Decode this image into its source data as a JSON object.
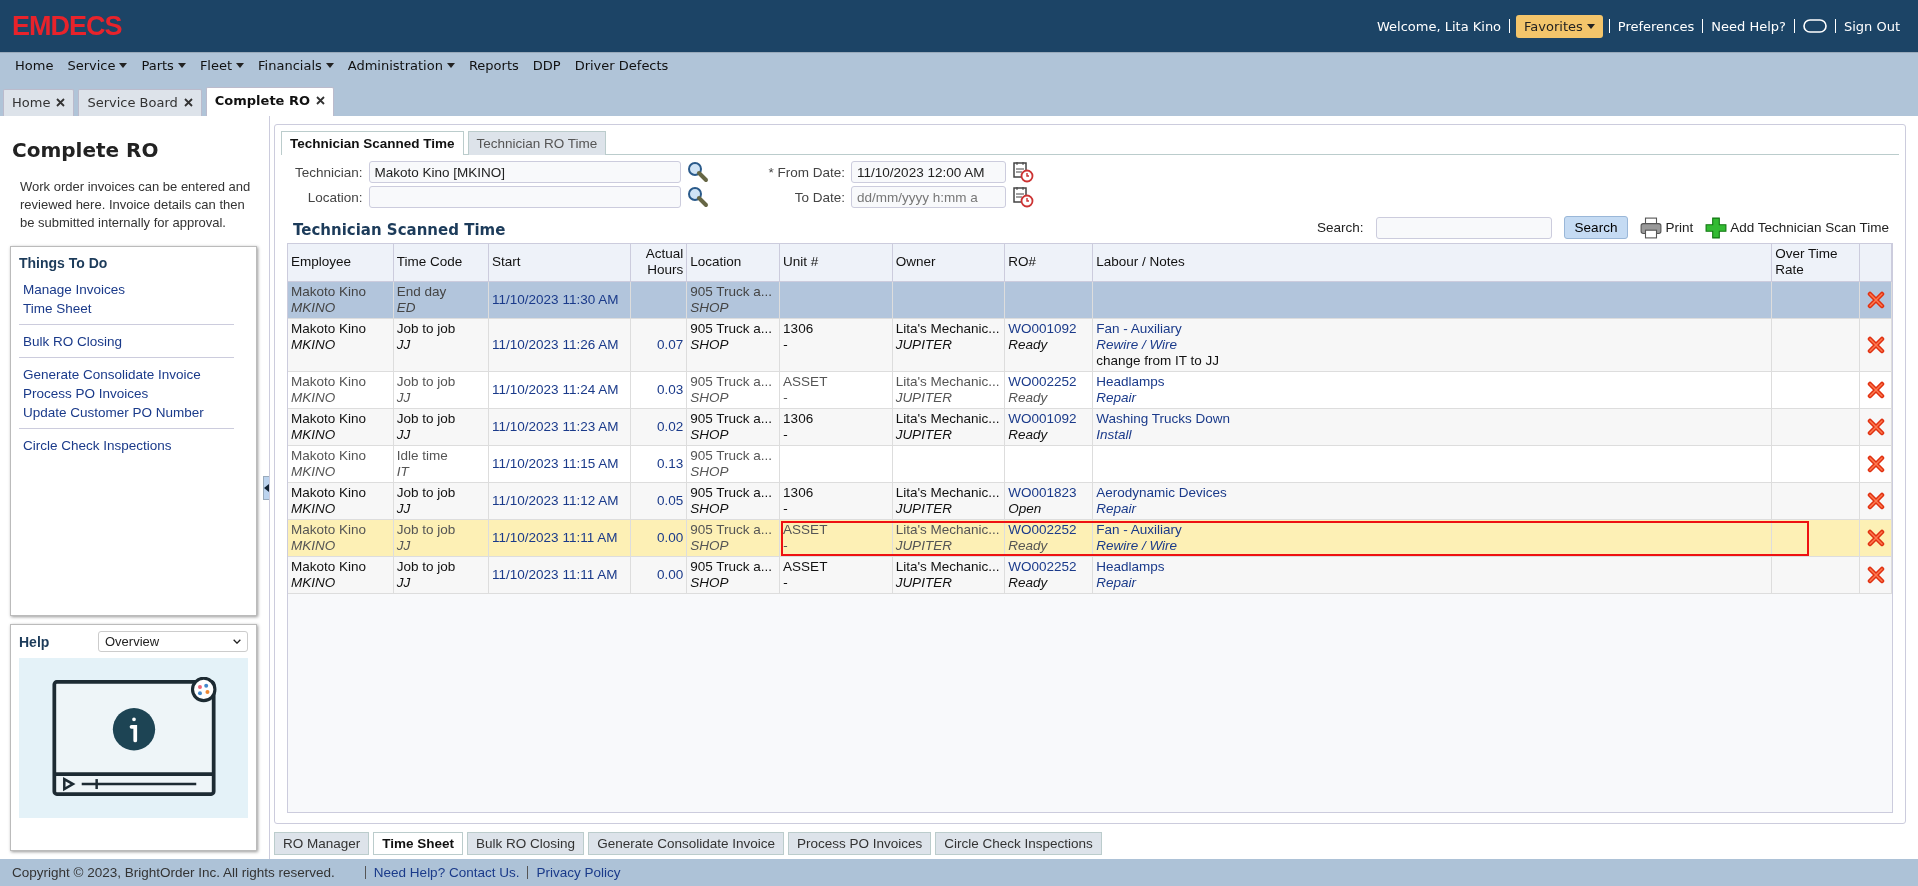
{
  "header": {
    "logo": "EMDECS",
    "welcome": "Welcome, Lita Kino",
    "favorites": "Favorites",
    "links": [
      {
        "kind": "link",
        "label": "Preferences"
      },
      {
        "kind": "link",
        "label": "Need Help?"
      },
      {
        "kind": "toggle"
      },
      {
        "kind": "link",
        "label": "Sign Out"
      }
    ]
  },
  "menu": [
    {
      "label": "Home",
      "has_menu": false
    },
    {
      "label": "Service",
      "has_menu": true
    },
    {
      "label": "Parts",
      "has_menu": true
    },
    {
      "label": "Fleet",
      "has_menu": true
    },
    {
      "label": "Financials",
      "has_menu": true
    },
    {
      "label": "Administration",
      "has_menu": true
    },
    {
      "label": "Reports",
      "has_menu": false
    },
    {
      "label": "DDP",
      "has_menu": false
    },
    {
      "label": "Driver Defects",
      "has_menu": false
    }
  ],
  "page_tabs": [
    {
      "label": "Home",
      "selected": false
    },
    {
      "label": "Service Board",
      "selected": false
    },
    {
      "label": "Complete RO",
      "selected": true
    }
  ],
  "sidebar": {
    "title": "Complete RO",
    "description": "Work order invoices can be entered and reviewed here. Invoice details can then be submitted internally for approval.",
    "things_to_do": {
      "title": "Things To Do",
      "groups": [
        [
          "Manage Invoices",
          "Time Sheet"
        ],
        [
          "Bulk RO Closing"
        ],
        [
          "Generate Consolidate Invoice",
          "Process PO Invoices",
          "Update Customer PO Number"
        ],
        [
          "Circle Check Inspections"
        ]
      ]
    },
    "help": {
      "title": "Help",
      "topic": "Overview"
    }
  },
  "content_tabs": [
    {
      "label": "Technician Scanned Time",
      "selected": true
    },
    {
      "label": "Technician RO Time",
      "selected": false
    }
  ],
  "filters": {
    "technician": {
      "label": "Technician:",
      "value": "Makoto Kino [MKINO]"
    },
    "location": {
      "label": "Location:"
    },
    "from_date": {
      "label": "* From Date:",
      "value": "11/10/2023 12:00 AM"
    },
    "to_date": {
      "label": "To Date:",
      "placeholder": "dd/mm/yyyy h:mm a"
    }
  },
  "section_title": "Technician Scanned Time",
  "toolbar": {
    "search_label": "Search:",
    "search_button": "Search",
    "print": "Print",
    "add": "Add Technician Scan Time"
  },
  "table": {
    "columns": [
      "Employee",
      "Time Code",
      "Start",
      "Actual Hours",
      "Location",
      "Unit #",
      "Owner",
      "RO#",
      "Labour / Notes",
      "Over Time Rate"
    ],
    "rows": [
      {
        "employee": "Makoto Kino",
        "employee_code": "MKINO",
        "time_code": "End day",
        "time_code_short": "ED",
        "start": "11/10/2023 11:30 AM",
        "location": "905 Truck a...",
        "location_code": "SHOP",
        "selected": true,
        "hovered": false,
        "outlined": false
      },
      {
        "employee": "Makoto Kino",
        "employee_code": "MKINO",
        "time_code": "Job to job",
        "time_code_short": "JJ",
        "start": "11/10/2023 11:26 AM",
        "hours": "0.07",
        "location": "905 Truck a...",
        "location_code": "SHOP",
        "unit": "1306",
        "unit_sub": "-",
        "owner": "Lita's Mechanic...",
        "owner_code": "JUPITER",
        "ro": "WO001092",
        "ro_status": "Ready",
        "labour": "Fan - Auxiliary",
        "labour_sub": "Rewire / Wire",
        "note": "change from IT to JJ",
        "selected": false,
        "hovered": false,
        "outlined": false
      },
      {
        "employee": "Makoto Kino",
        "employee_code": "MKINO",
        "time_code": "Job to job",
        "time_code_short": "JJ",
        "start": "11/10/2023 11:24 AM",
        "hours": "0.03",
        "location": "905 Truck a...",
        "location_code": "SHOP",
        "unit": "ASSET",
        "unit_sub": "-",
        "owner": "Lita's Mechanic...",
        "owner_code": "JUPITER",
        "ro": "WO002252",
        "ro_status": "Ready",
        "labour": "Headlamps",
        "labour_sub": "Repair",
        "selected": false,
        "hovered": false,
        "outlined": false
      },
      {
        "employee": "Makoto Kino",
        "employee_code": "MKINO",
        "time_code": "Job to job",
        "time_code_short": "JJ",
        "start": "11/10/2023 11:23 AM",
        "hours": "0.02",
        "location": "905 Truck a...",
        "location_code": "SHOP",
        "unit": "1306",
        "unit_sub": "-",
        "owner": "Lita's Mechanic...",
        "owner_code": "JUPITER",
        "ro": "WO001092",
        "ro_status": "Ready",
        "labour": "Washing Trucks Down",
        "labour_sub": "Install",
        "selected": false,
        "hovered": false,
        "outlined": false
      },
      {
        "employee": "Makoto Kino",
        "employee_code": "MKINO",
        "time_code": "Idle time",
        "time_code_short": "IT",
        "start": "11/10/2023 11:15 AM",
        "hours": "0.13",
        "location": "905 Truck a...",
        "location_code": "SHOP",
        "selected": false,
        "hovered": false,
        "outlined": false
      },
      {
        "employee": "Makoto Kino",
        "employee_code": "MKINO",
        "time_code": "Job to job",
        "time_code_short": "JJ",
        "start": "11/10/2023 11:12 AM",
        "hours": "0.05",
        "location": "905 Truck a...",
        "location_code": "SHOP",
        "unit": "1306",
        "unit_sub": "-",
        "owner": "Lita's Mechanic...",
        "owner_code": "JUPITER",
        "ro": "WO001823",
        "ro_status": "Open",
        "labour": "Aerodynamic Devices",
        "labour_sub": "Repair",
        "selected": false,
        "hovered": false,
        "outlined": false
      },
      {
        "employee": "Makoto Kino",
        "employee_code": "MKINO",
        "time_code": "Job to job",
        "time_code_short": "JJ",
        "start": "11/10/2023 11:11 AM",
        "hours": "0.00",
        "location": "905 Truck a...",
        "location_code": "SHOP",
        "unit": "ASSET",
        "unit_sub": "-",
        "owner": "Lita's Mechanic...",
        "owner_code": "JUPITER",
        "ro": "WO002252",
        "ro_status": "Ready",
        "labour": "Fan - Auxiliary",
        "labour_sub": "Rewire / Wire",
        "selected": false,
        "hovered": true,
        "outlined": true
      },
      {
        "employee": "Makoto Kino",
        "employee_code": "MKINO",
        "time_code": "Job to job",
        "time_code_short": "JJ",
        "start": "11/10/2023 11:11 AM",
        "hours": "0.00",
        "location": "905 Truck a...",
        "location_code": "SHOP",
        "unit": "ASSET",
        "unit_sub": "-",
        "owner": "Lita's Mechanic...",
        "owner_code": "JUPITER",
        "ro": "WO002252",
        "ro_status": "Ready",
        "labour": "Headlamps",
        "labour_sub": "Repair",
        "selected": false,
        "hovered": false,
        "outlined": false
      }
    ]
  },
  "bottom_tabs": [
    {
      "label": "RO Manager",
      "selected": false
    },
    {
      "label": "Time Sheet",
      "selected": true
    },
    {
      "label": "Bulk RO Closing",
      "selected": false
    },
    {
      "label": "Generate Consolidate Invoice",
      "selected": false
    },
    {
      "label": "Process PO Invoices",
      "selected": false
    },
    {
      "label": "Circle Check Inspections",
      "selected": false
    }
  ],
  "footer": {
    "copyright": "Copyright © 2023, BrightOrder Inc. All rights reserved.",
    "links": [
      "Need Help? Contact Us.",
      "Privacy Policy"
    ]
  }
}
